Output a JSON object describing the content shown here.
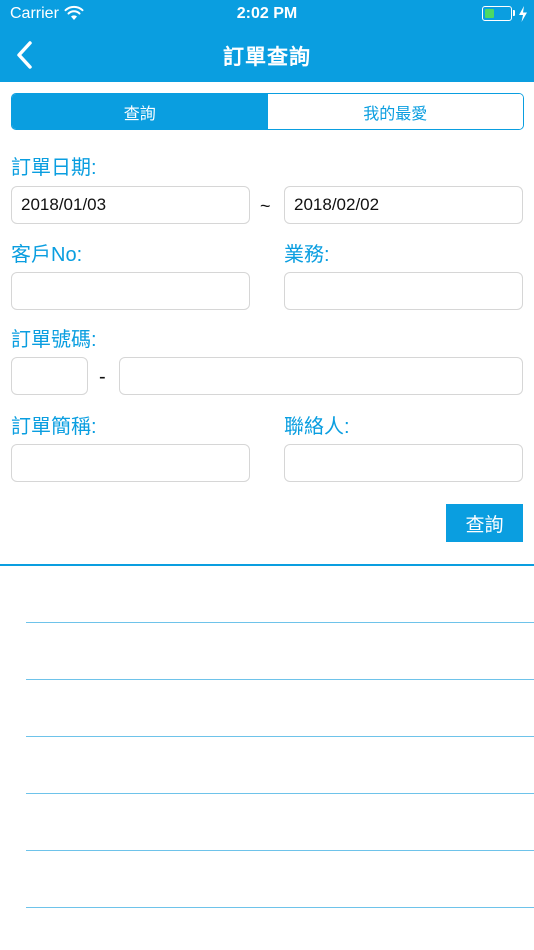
{
  "status_bar": {
    "carrier": "Carrier",
    "time": "2:02 PM",
    "battery_level": 0.4
  },
  "nav": {
    "title": "訂單查詢",
    "back_icon": "chevron-left-icon"
  },
  "tabs": [
    {
      "label": "查詢",
      "active": true
    },
    {
      "label": "我的最愛",
      "active": false
    }
  ],
  "form": {
    "order_date_label": "訂單日期:",
    "date_from": "2018/01/03",
    "date_to": "2018/02/02",
    "range_separator": "~",
    "customer_no_label": "客戶No:",
    "customer_no_value": "",
    "sales_label": "業務:",
    "sales_value": "",
    "order_no_label": "訂單號碼:",
    "order_no_prefix": "",
    "order_no_separator": "-",
    "order_no_value": "",
    "order_short_label": "訂單簡稱:",
    "order_short_value": "",
    "contact_label": "聯絡人:",
    "contact_value": ""
  },
  "actions": {
    "query_label": "查詢"
  },
  "colors": {
    "accent": "#0a9ee0",
    "field_border": "#d6d6d6",
    "result_divider": "#6ec3ea",
    "battery": "#4cd964"
  }
}
